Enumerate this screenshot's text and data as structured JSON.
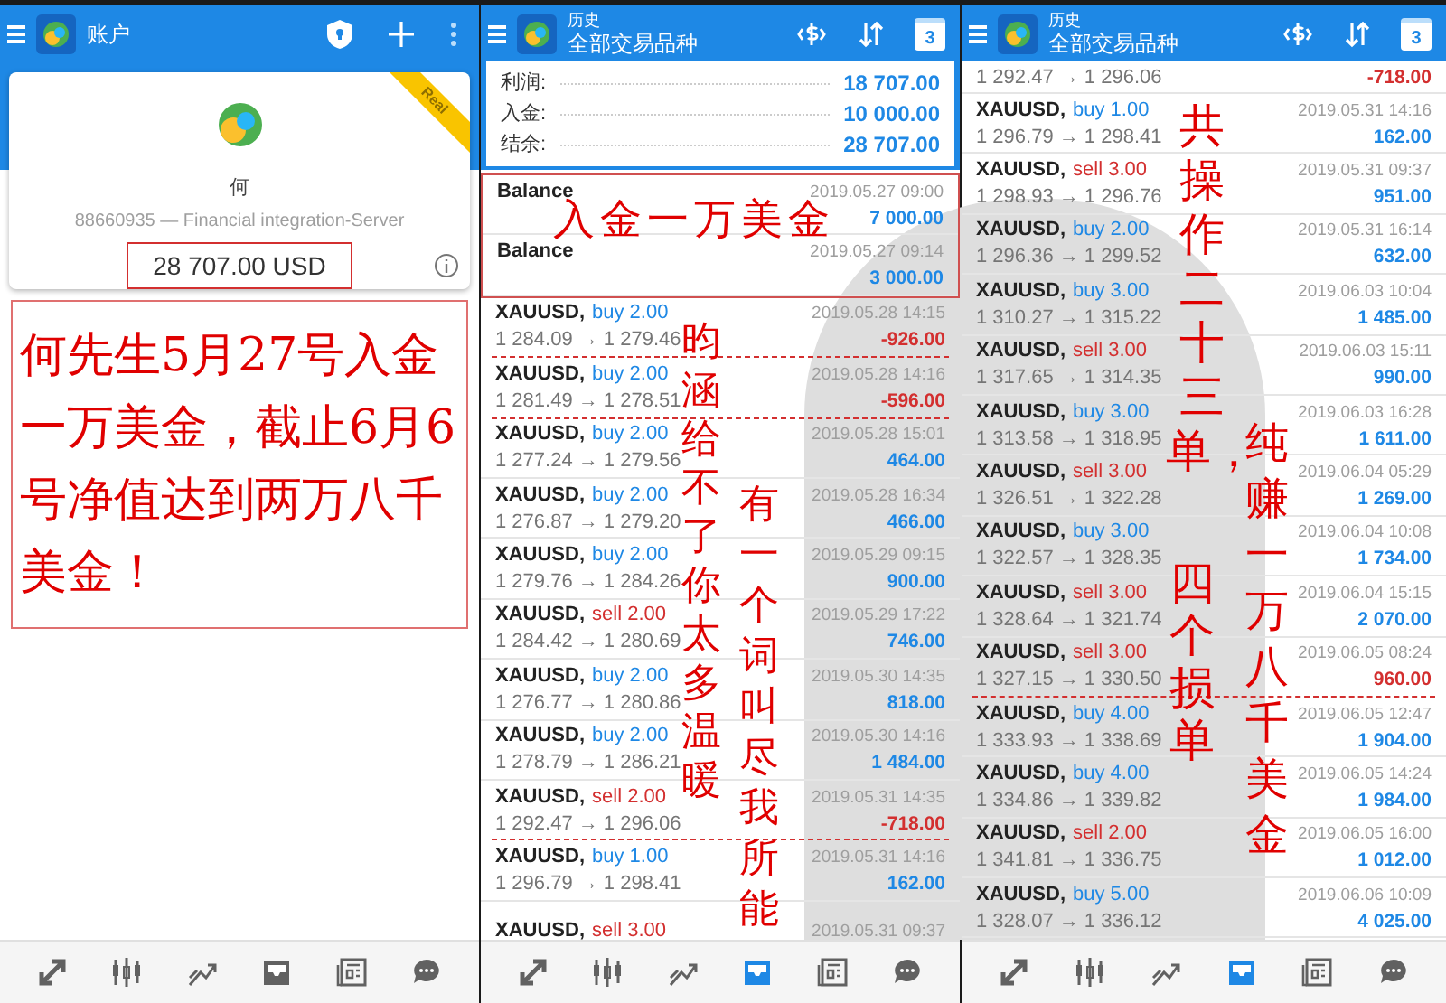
{
  "account_panel": {
    "title": "账户",
    "badge": "Real",
    "name": "何",
    "server": "88660935 — Financial integration-Server",
    "balance": "28 707.00 USD"
  },
  "history_panels": [
    {
      "subtitle": "历史",
      "title": "全部交易品种",
      "calendar_day": "3",
      "summary": [
        {
          "label": "利润:",
          "value": "18 707.00"
        },
        {
          "label": "入金:",
          "value": "10 000.00"
        },
        {
          "label": "结余:",
          "value": "28 707.00"
        }
      ],
      "rows": [
        {
          "kind": "balance",
          "symbol": "Balance",
          "time": "2019.05.27 09:00",
          "profit": "7 000.00",
          "color": "#1e88e5",
          "marked": false
        },
        {
          "kind": "balance",
          "symbol": "Balance",
          "time": "2019.05.27 09:14",
          "profit": "3 000.00",
          "color": "#1e88e5",
          "marked": false
        },
        {
          "kind": "buy",
          "symbol": "XAUUSD,",
          "action": "buy 2.00",
          "prices": "1 284.09 → 1 279.46",
          "time": "2019.05.28 14:15",
          "profit": "-926.00",
          "color": "#d32f2f",
          "marked": true
        },
        {
          "kind": "buy",
          "symbol": "XAUUSD,",
          "action": "buy 2.00",
          "prices": "1 281.49 → 1 278.51",
          "time": "2019.05.28 14:16",
          "profit": "-596.00",
          "color": "#d32f2f",
          "marked": true
        },
        {
          "kind": "buy",
          "symbol": "XAUUSD,",
          "action": "buy 2.00",
          "prices": "1 277.24 → 1 279.56",
          "time": "2019.05.28 15:01",
          "profit": "464.00",
          "color": "#1e88e5",
          "marked": false
        },
        {
          "kind": "buy",
          "symbol": "XAUUSD,",
          "action": "buy 2.00",
          "prices": "1 276.87 → 1 279.20",
          "time": "2019.05.28 16:34",
          "profit": "466.00",
          "color": "#1e88e5",
          "marked": false
        },
        {
          "kind": "buy",
          "symbol": "XAUUSD,",
          "action": "buy 2.00",
          "prices": "1 279.76 → 1 284.26",
          "time": "2019.05.29 09:15",
          "profit": "900.00",
          "color": "#1e88e5",
          "marked": false
        },
        {
          "kind": "sell",
          "symbol": "XAUUSD,",
          "action": "sell 2.00",
          "prices": "1 284.42 → 1 280.69",
          "time": "2019.05.29 17:22",
          "profit": "746.00",
          "color": "#1e88e5",
          "marked": false
        },
        {
          "kind": "buy",
          "symbol": "XAUUSD,",
          "action": "buy 2.00",
          "prices": "1 276.77 → 1 280.86",
          "time": "2019.05.30 14:35",
          "profit": "818.00",
          "color": "#1e88e5",
          "marked": false
        },
        {
          "kind": "buy",
          "symbol": "XAUUSD,",
          "action": "buy 2.00",
          "prices": "1 278.79 → 1 286.21",
          "time": "2019.05.30 14:16",
          "profit": "1 484.00",
          "color": "#1e88e5",
          "marked": false
        },
        {
          "kind": "sell",
          "symbol": "XAUUSD,",
          "action": "sell 2.00",
          "prices": "1 292.47 → 1 296.06",
          "time": "2019.05.31 14:35",
          "profit": "-718.00",
          "color": "#d32f2f",
          "marked": true
        },
        {
          "kind": "buy",
          "symbol": "XAUUSD,",
          "action": "buy 1.00",
          "prices": "1 296.79 → 1 298.41",
          "time": "2019.05.31 14:16",
          "profit": "162.00",
          "color": "#1e88e5",
          "marked": false
        },
        {
          "kind": "sell",
          "symbol": "XAUUSD,",
          "action": "sell 3.00",
          "time": "2019.05.31 09:37"
        }
      ]
    },
    {
      "subtitle": "历史",
      "title": "全部交易品种",
      "calendar_day": "3",
      "rows": [
        {
          "kind": "sell",
          "prices": "1 292.47 → 1 296.06",
          "profit": "-718.00",
          "color": "#d32f2f",
          "marked": false
        },
        {
          "kind": "buy",
          "symbol": "XAUUSD,",
          "action": "buy 1.00",
          "prices": "1 296.79 → 1 298.41",
          "time": "2019.05.31 14:16",
          "profit": "162.00",
          "color": "#1e88e5",
          "marked": false
        },
        {
          "kind": "sell",
          "symbol": "XAUUSD,",
          "action": "sell 3.00",
          "prices": "1 298.93 → 1 296.76",
          "time": "2019.05.31 09:37",
          "profit": "951.00",
          "color": "#1e88e5",
          "marked": false
        },
        {
          "kind": "buy",
          "symbol": "XAUUSD,",
          "action": "buy 2.00",
          "prices": "1 296.36 → 1 299.52",
          "time": "2019.05.31 16:14",
          "profit": "632.00",
          "color": "#1e88e5",
          "marked": false
        },
        {
          "kind": "buy",
          "symbol": "XAUUSD,",
          "action": "buy 3.00",
          "prices": "1 310.27 → 1 315.22",
          "time": "2019.06.03 10:04",
          "profit": "1 485.00",
          "color": "#1e88e5",
          "marked": false
        },
        {
          "kind": "sell",
          "symbol": "XAUUSD,",
          "action": "sell 3.00",
          "prices": "1 317.65 → 1 314.35",
          "time": "2019.06.03 15:11",
          "profit": "990.00",
          "color": "#1e88e5",
          "marked": false
        },
        {
          "kind": "buy",
          "symbol": "XAUUSD,",
          "action": "buy 3.00",
          "prices": "1 313.58 → 1 318.95",
          "time": "2019.06.03 16:28",
          "profit": "1 611.00",
          "color": "#1e88e5",
          "marked": false
        },
        {
          "kind": "sell",
          "symbol": "XAUUSD,",
          "action": "sell 3.00",
          "prices": "1 326.51 → 1 322.28",
          "time": "2019.06.04 05:29",
          "profit": "1 269.00",
          "color": "#1e88e5",
          "marked": false
        },
        {
          "kind": "buy",
          "symbol": "XAUUSD,",
          "action": "buy 3.00",
          "prices": "1 322.57 → 1 328.35",
          "time": "2019.06.04 10:08",
          "profit": "1 734.00",
          "color": "#1e88e5",
          "marked": false
        },
        {
          "kind": "sell",
          "symbol": "XAUUSD,",
          "action": "sell 3.00",
          "prices": "1 328.64 → 1 321.74",
          "time": "2019.06.04 15:15",
          "profit": "2 070.00",
          "color": "#1e88e5",
          "marked": false
        },
        {
          "kind": "sell",
          "symbol": "XAUUSD,",
          "action": "sell 3.00",
          "prices": "1 327.15 → 1 330.50",
          "time": "2019.06.05 08:24",
          "profit": "960.00",
          "color": "#d32f2f",
          "marked": true
        },
        {
          "kind": "buy",
          "symbol": "XAUUSD,",
          "action": "buy 4.00",
          "prices": "1 333.93 → 1 338.69",
          "time": "2019.06.05 12:47",
          "profit": "1 904.00",
          "color": "#1e88e5",
          "marked": false
        },
        {
          "kind": "buy",
          "symbol": "XAUUSD,",
          "action": "buy 4.00",
          "prices": "1 334.86 → 1 339.82",
          "time": "2019.06.05 14:24",
          "profit": "1 984.00",
          "color": "#1e88e5",
          "marked": false
        },
        {
          "kind": "sell",
          "symbol": "XAUUSD,",
          "action": "sell 2.00",
          "prices": "1 341.81 → 1 336.75",
          "time": "2019.06.05 16:00",
          "profit": "1 012.00",
          "color": "#1e88e5",
          "marked": false
        },
        {
          "kind": "buy",
          "symbol": "XAUUSD,",
          "action": "buy 5.00",
          "prices": "1 328.07 → 1 336.12",
          "time": "2019.06.06 10:09",
          "profit": "4 025.00",
          "color": "#1e88e5",
          "marked": false
        }
      ]
    }
  ],
  "nav_bars": [
    [
      {
        "selected": false
      },
      {
        "selected": false
      },
      {
        "selected": false
      },
      {
        "selected": false
      },
      {
        "selected": false
      },
      {
        "selected": false
      }
    ],
    [
      {
        "selected": false
      },
      {
        "selected": false
      },
      {
        "selected": false
      },
      {
        "selected": true
      },
      {
        "selected": false
      },
      {
        "selected": false
      }
    ],
    [
      {
        "selected": false
      },
      {
        "selected": false
      },
      {
        "selected": false
      },
      {
        "selected": true
      },
      {
        "selected": false
      },
      {
        "selected": false
      }
    ]
  ],
  "annotations": {
    "summary_note": "何先生5月27号入金一万美金，截止6月6号净值达到两万八千美金！",
    "deposit_note": "入金一万美金",
    "vertical_notes": [
      "昀涵给不了你太多温暖",
      "有一个词叫尽我所能",
      "共操作二十三单，",
      "四个损单",
      "纯赚一万八千美金"
    ]
  }
}
